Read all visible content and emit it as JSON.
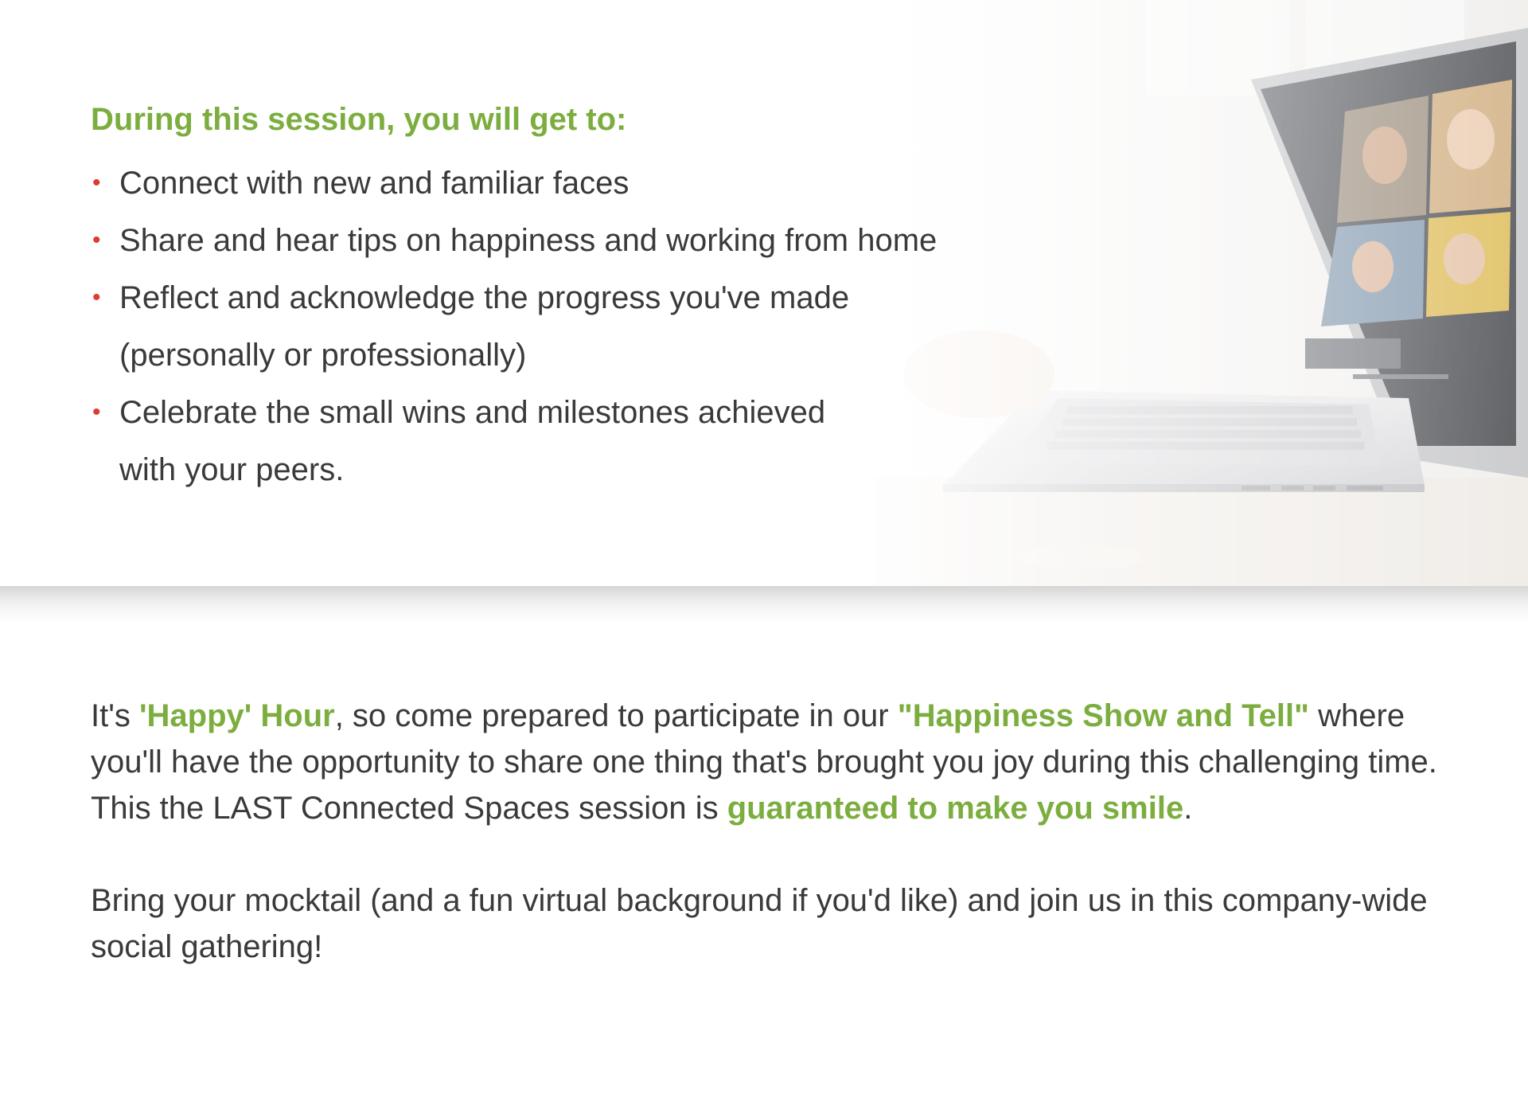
{
  "hero": {
    "intro": "During this session, you will get to:",
    "bullets": [
      {
        "line1": "Connect with new and familiar faces",
        "line2": ""
      },
      {
        "line1": "Share and hear tips on happiness and working from home",
        "line2": ""
      },
      {
        "line1": "Reflect and acknowledge the progress you've made",
        "line2": "(personally or professionally)"
      },
      {
        "line1": "Celebrate the small wins and milestones achieved",
        "line2": "with your peers."
      }
    ],
    "bullet_glyph": "•",
    "image": "laptop-video-call-photo"
  },
  "body": {
    "p1": {
      "a": "It's ",
      "b": "'Happy' Hour",
      "c": ", so come prepared to participate in our ",
      "d": "\"Happiness Show and Tell\"",
      "e": " where you'll have the opportunity to share one thing that's brought you joy during this challenging time. This the LAST Connected Spaces session is ",
      "f": "guaranteed to make you smile",
      "g": "."
    },
    "p2": "Bring your mocktail (and a fun virtual background if you'd like) and join us in this company-wide social gathering!"
  },
  "colors": {
    "accent_green": "#7cae3f",
    "bullet_red": "#e03a32",
    "text": "#3a3a3a"
  }
}
